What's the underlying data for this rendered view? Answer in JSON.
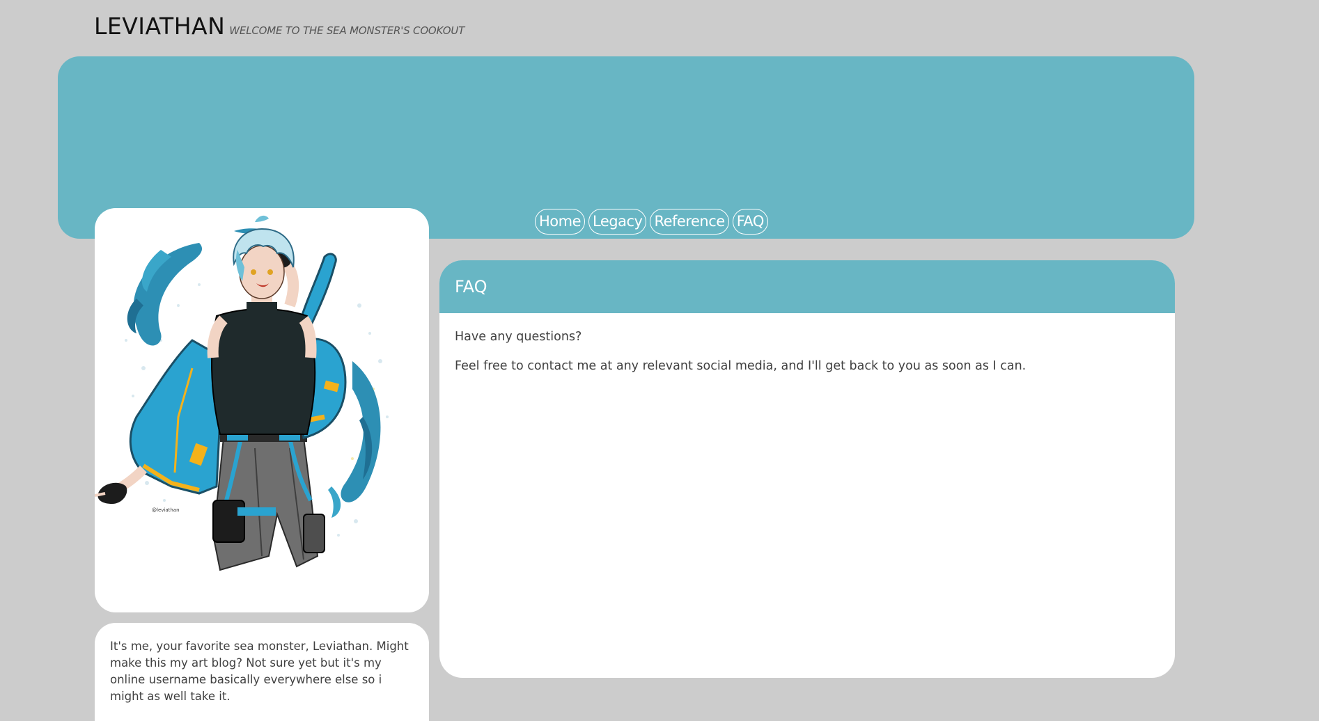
{
  "site": {
    "title": "LEVIATHAN",
    "tagline": "WELCOME TO THE SEA MONSTER'S COOKOUT"
  },
  "nav": {
    "items": [
      {
        "label": "Home"
      },
      {
        "label": "Legacy"
      },
      {
        "label": "Reference"
      },
      {
        "label": "FAQ"
      }
    ]
  },
  "portrait": {
    "icon": "character-illustration",
    "signature": "@leviathan art"
  },
  "bio": {
    "text": "It's me, your favorite sea monster, Leviathan. Might make this my art blog? Not sure yet but it's my online username basically everywhere else so i might as well take it."
  },
  "faq": {
    "title": "FAQ",
    "lines": [
      "Have any questions?",
      "Feel free to contact me at any relevant social media, and I'll get back to you as soon as I can."
    ]
  },
  "colors": {
    "background": "#cccccc",
    "accent": "#68b6c4",
    "card": "#ffffff",
    "text": "#404040",
    "title": "#111111"
  }
}
